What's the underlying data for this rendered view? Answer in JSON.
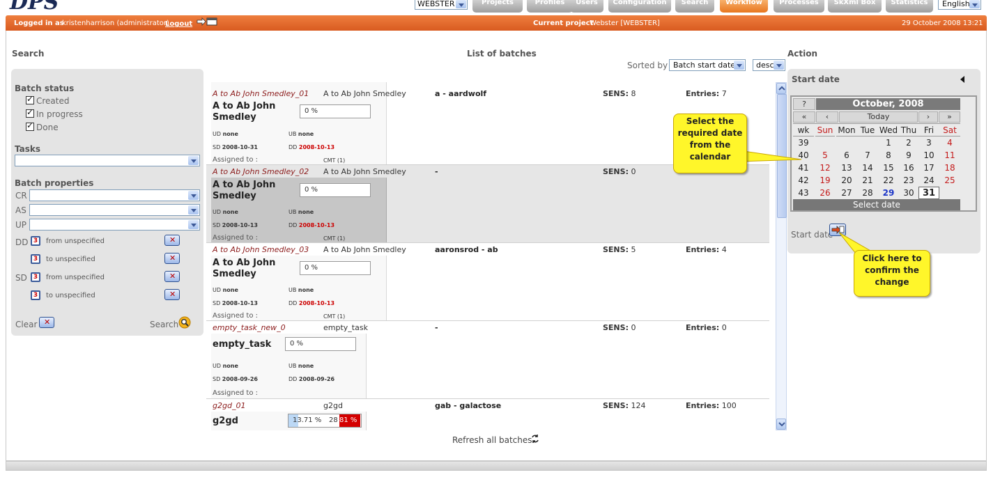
{
  "app": {
    "logo": "DPS",
    "language": "English"
  },
  "nav": {
    "project_select": "WEBSTER",
    "tabs": [
      "Projects",
      "Profiles",
      "Users",
      "Configuration",
      "Search",
      "Workflow",
      "Processes",
      "SkXml Box",
      "Statistics"
    ],
    "active_tab": "Workflow"
  },
  "statusbar": {
    "logged_in_label": "Logged in as",
    "user": "kristenharrison (administrator)",
    "logout": "Logout",
    "current_project_label": "Current project",
    "current_project": "Webster [WEBSTER]",
    "datetime": "29 October 2008 13:21"
  },
  "search": {
    "title": "Search",
    "batch_status_label": "Batch status",
    "statuses": [
      "Created",
      "In progress",
      "Done"
    ],
    "tasks_label": "Tasks",
    "batch_properties_label": "Batch properties",
    "props": [
      "CR",
      "AS",
      "UP"
    ],
    "dd_label": "DD",
    "sd_label": "SD",
    "from_unspecified": "from unspecified",
    "to_unspecified": "to unspecified",
    "clear": "Clear",
    "search_btn": "Search"
  },
  "list": {
    "title": "List of batches",
    "sorted_by_label": "Sorted by",
    "sort_field": "Batch start date",
    "sort_order": "desc",
    "refresh": "Refresh all batches",
    "assigned_label": "Assigned to :",
    "sens_label": "SENS:",
    "entries_label": "Entries:",
    "batches": [
      {
        "name": "A to Ab John Smedley_01",
        "task": "A to Ab John Smedley",
        "words": "a - aardwolf",
        "sens": "8",
        "entries": "7",
        "big": "A to Ab John Smedley",
        "progress": "0 %",
        "ud": "none",
        "ub": "none",
        "sd": "2008-10-31",
        "dd": "2008-10-13",
        "cmt": "CMT (1)"
      },
      {
        "name": "A to Ab John Smedley_02",
        "task": "A to Ab John Smedley",
        "words": "-",
        "sens": "0",
        "entries": "",
        "big": "A to Ab John Smedley",
        "progress": "0 %",
        "ud": "none",
        "ub": "none",
        "sd": "2008-10-13",
        "dd": "2008-10-13",
        "cmt": "CMT (1)"
      },
      {
        "name": "A to Ab John Smedley_03",
        "task": "A to Ab John Smedley",
        "words": "aaronsrod - ab",
        "sens": "5",
        "entries": "4",
        "big": "A to Ab John Smedley",
        "progress": "0 %",
        "ud": "none",
        "ub": "none",
        "sd": "2008-10-13",
        "dd": "2008-10-13",
        "cmt": "CMT (1)"
      },
      {
        "name": "empty_task_new_0",
        "task": "empty_task",
        "words": "-",
        "sens": "0",
        "entries": "0",
        "big": "empty_task",
        "progress": "0 %",
        "ud": "none",
        "ub": "none",
        "sd": "2008-09-26",
        "dd": "2008-09-26",
        "cmt": ""
      },
      {
        "name": "g2gd_01",
        "task": "g2gd",
        "words": "gab - galactose",
        "sens": "124",
        "entries": "100",
        "big": "g2gd",
        "progress": "13.71 %",
        "progress_val": 13.71,
        "progress2": "28",
        "progress2_red": "81 %"
      }
    ]
  },
  "action": {
    "title": "Action",
    "start_date_label": "Start date",
    "start_date_field": "Start date",
    "calendar": {
      "help": "?",
      "month": "October, 2008",
      "nav": [
        "«",
        "‹",
        "Today",
        "›",
        "»"
      ],
      "headers": [
        "wk",
        "Sun",
        "Mon",
        "Tue",
        "Wed",
        "Thu",
        "Fri",
        "Sat"
      ],
      "weeks": [
        [
          "39",
          "",
          "",
          "",
          "1",
          "2",
          "3",
          "4"
        ],
        [
          "40",
          "5",
          "6",
          "7",
          "8",
          "9",
          "10",
          "11"
        ],
        [
          "41",
          "12",
          "13",
          "14",
          "15",
          "16",
          "17",
          "18"
        ],
        [
          "42",
          "19",
          "20",
          "21",
          "22",
          "23",
          "24",
          "25"
        ],
        [
          "43",
          "26",
          "27",
          "28",
          "29",
          "30",
          "31",
          ""
        ]
      ],
      "today": "29",
      "selected": "31",
      "footer": "Select date"
    }
  },
  "callouts": {
    "calendar_tip": "Select the required date from the calendar",
    "confirm_tip": "Click here to confirm the change"
  },
  "colors": {
    "accent": "#e0672a",
    "callout": "#fff62a",
    "batch_name": "#8b1a1a"
  }
}
